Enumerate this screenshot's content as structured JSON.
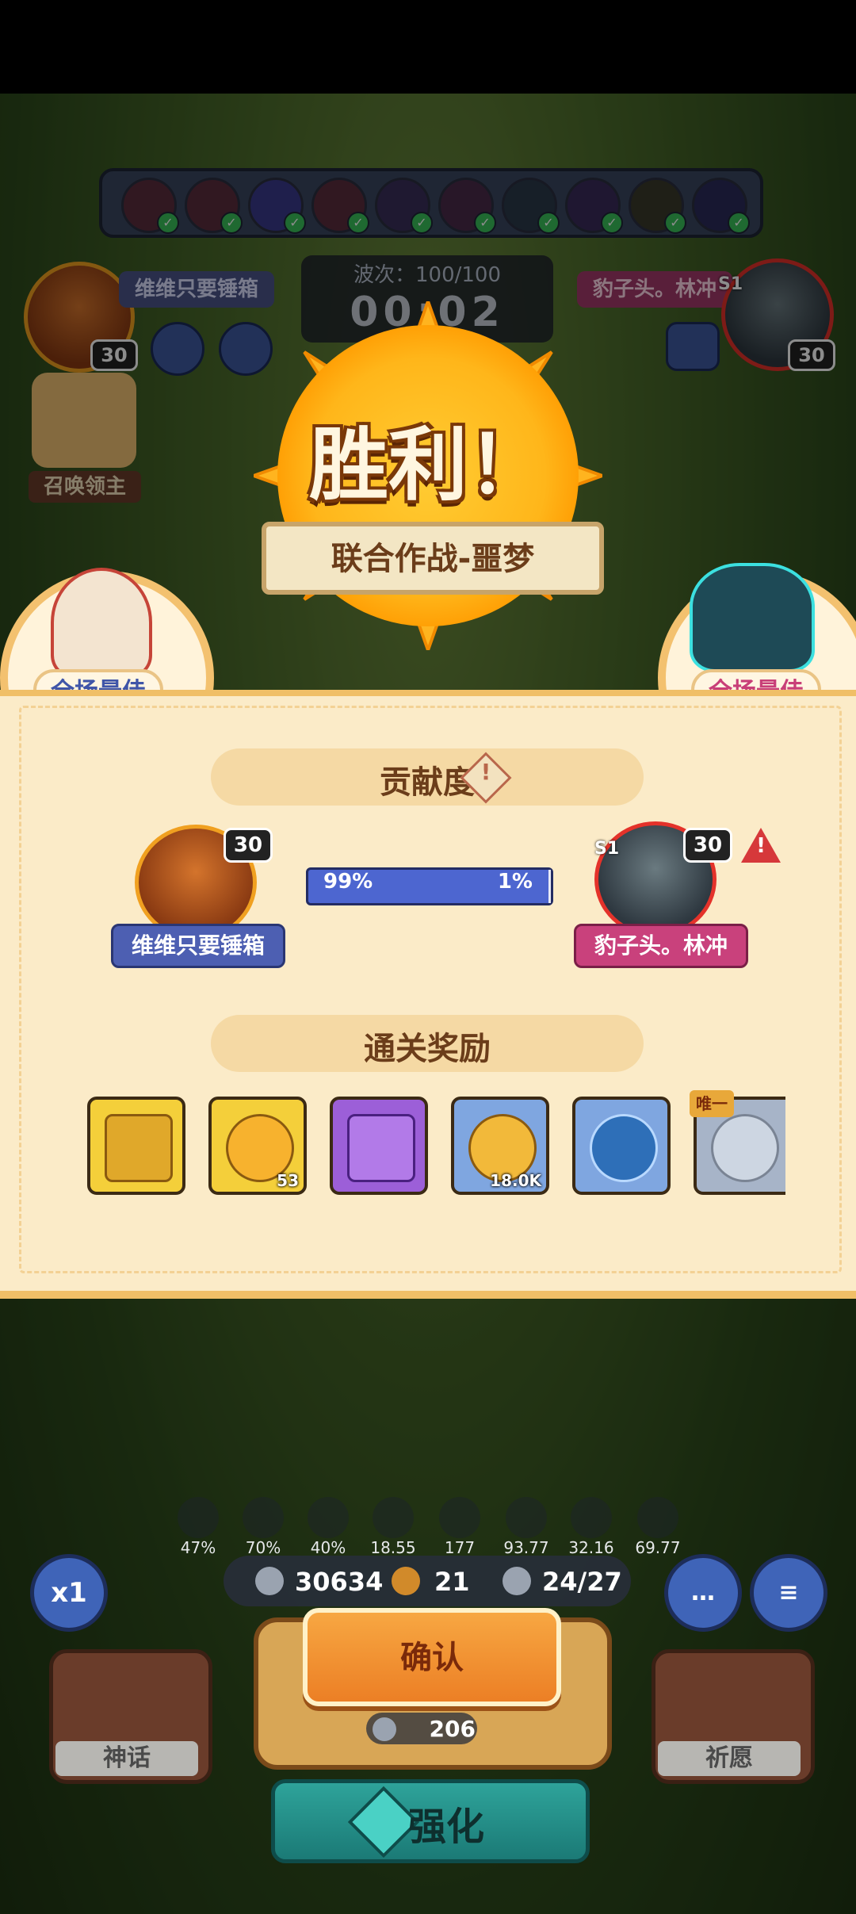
{
  "battle": {
    "wave": "波次：100/100",
    "timer": "00:02",
    "player1_name": "维维只要锤箱",
    "player2_name": "豹子头。林冲",
    "player1_level": "30",
    "player2_level": "30",
    "player2_season": "S1",
    "summon_lord_label": "召唤领主"
  },
  "victory": {
    "title": "胜利！",
    "mode": "联合作战-噩梦"
  },
  "mvp": {
    "left_label": "全场最佳",
    "right_label": "全场最佳"
  },
  "contribution": {
    "title": "贡献度",
    "info_icon": "info-icon",
    "player1": {
      "name": "维维只要锤箱",
      "level": "30",
      "percent": "99%"
    },
    "player2": {
      "name": "豹子头。林冲",
      "level": "30",
      "season": "S1",
      "percent": "1%"
    },
    "player1_share": 0.99,
    "colors": {
      "player1": "#4d66d0",
      "player2": "#e7e9f5"
    }
  },
  "rewards": {
    "title": "通关奖励",
    "items": [
      {
        "icon": "gold-chest-icon",
        "count": "",
        "tag": ""
      },
      {
        "icon": "gold-key-icon",
        "count": "53",
        "tag": ""
      },
      {
        "icon": "purple-chest-icon",
        "count": "",
        "tag": ""
      },
      {
        "icon": "gold-coin-icon",
        "count": "18.0K",
        "tag": ""
      },
      {
        "icon": "blue-sword-emblem-icon",
        "count": "",
        "tag": ""
      },
      {
        "icon": "silver-gear-emblem-icon",
        "count": "",
        "tag": "唯一"
      }
    ]
  },
  "hud": {
    "stats": [
      "47%",
      "70%",
      "40%",
      "18.55",
      "177",
      "93.77",
      "32.16",
      "69.77"
    ],
    "resources": {
      "silver": "30634",
      "clover": "21",
      "units": "24/27"
    },
    "speed": "x1",
    "confirm_label": "确认",
    "cost": "206",
    "enhance_label": "强化",
    "myth_label": "神话",
    "wish_label": "祈愿"
  }
}
